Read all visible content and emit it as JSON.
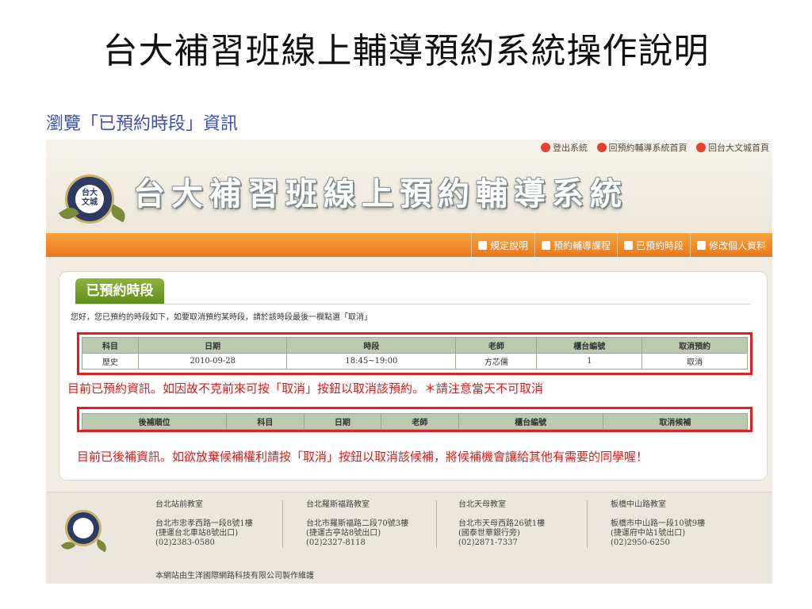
{
  "slide": {
    "title": "台大補習班線上輔導預約系統操作說明",
    "subtitle": "瀏覽「已預約時段」資訊"
  },
  "header": {
    "logo_text": "台大\n文城",
    "site_title": "台大補習班線上預約輔導系統",
    "top_links": [
      {
        "label": "登出系統",
        "icon": "logout-icon",
        "color": "#e8402a"
      },
      {
        "label": "回預約輔導系統首頁",
        "icon": "home-icon",
        "color": "#e8402a"
      },
      {
        "label": "回台大文城首頁",
        "icon": "home-icon",
        "color": "#e8402a"
      }
    ]
  },
  "nav": {
    "items": [
      {
        "label": "規定說明",
        "icon": "rules-icon"
      },
      {
        "label": "預約輔導課程",
        "icon": "course-icon"
      },
      {
        "label": "已預約時段",
        "icon": "booked-icon"
      },
      {
        "label": "修改個人資料",
        "icon": "profile-icon"
      }
    ]
  },
  "panel": {
    "title": "已預約時段",
    "notice": "您好，您已預約的時段如下，如要取消預約某時段，請於該時段最後一欄點選「取消」",
    "booked_table": {
      "headers": [
        "科目",
        "日期",
        "時段",
        "老師",
        "櫃台編號",
        "取消預約"
      ],
      "rows": [
        [
          "歷史",
          "2010-09-28",
          "18:45~19:00",
          "方芯儒",
          "1",
          "取消"
        ]
      ]
    },
    "waitlist_table": {
      "headers": [
        "後補順位",
        "科目",
        "日期",
        "老師",
        "櫃台編號",
        "取消候補"
      ]
    },
    "note_booked": "目前已預約資訊。如因故不克前來可按「取消」按鈕以取消該預約。＊請注意當天不可取消",
    "note_waitlist": "目前已後補資訊。如欲放棄候補權利請按「取消」按鈕以取消該候補，將候補機會讓給其他有需要的同學喔！"
  },
  "footer": {
    "branches": [
      {
        "name": "台北站前教室",
        "lines": [
          "台北市忠孝西路一段8號1樓",
          "(捷運台北車站8號出口)",
          "(02)2383-0580"
        ]
      },
      {
        "name": "台北羅斯福路教室",
        "lines": [
          "台北市羅斯福路二段70號3樓",
          "(捷運古亭站8號出口)",
          "(02)2327-8118"
        ]
      },
      {
        "name": "台北天母教室",
        "lines": [
          "台北市天母西路26號1樓",
          "(國泰世華銀行旁)",
          "(02)2871-7337"
        ]
      },
      {
        "name": "板橋中山路教室",
        "lines": [
          "板橋市中山路一段10號9樓",
          "(捷運府中站1號出口)",
          "(02)2950-6250"
        ]
      }
    ],
    "credit": "本網站由生洋國際網路科技有限公司製作維護"
  },
  "colors": {
    "nav_orange": "#ef8a2a",
    "panel_green": "#7aa22b",
    "alert_red": "#e01818",
    "link_blue": "#2a6bd0",
    "subtitle_blue": "#3f4fb0"
  }
}
